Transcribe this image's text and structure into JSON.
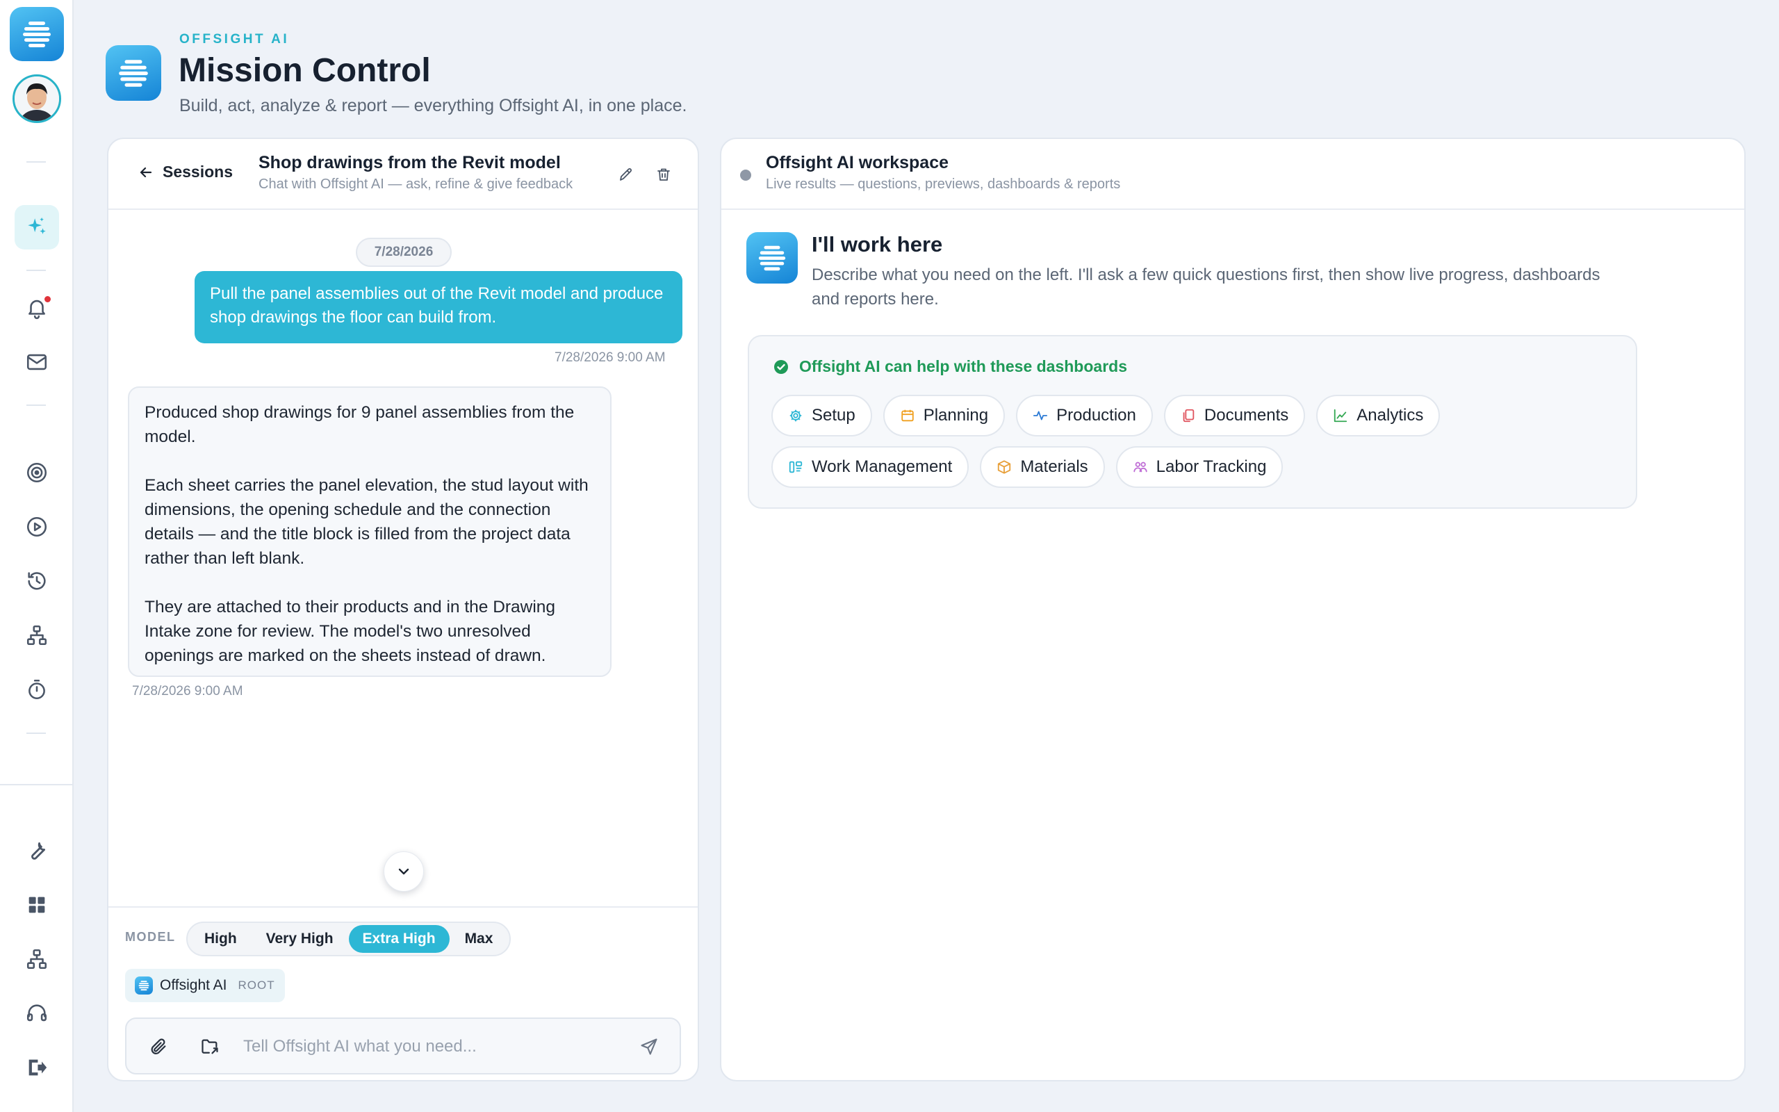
{
  "header": {
    "brand": "OFFSIGHT AI",
    "title": "Mission Control",
    "subtitle": "Build, act, analyze & report — everything Offsight AI, in one place."
  },
  "sidebar": {
    "top_items": [
      "ai-assistant",
      "notifications",
      "mail",
      "targets",
      "playback",
      "history",
      "hierarchy",
      "timer"
    ],
    "bottom_items": [
      "tools",
      "dashboards",
      "network",
      "support",
      "logout"
    ]
  },
  "chat": {
    "back_label": "Sessions",
    "session_title": "Shop drawings from the Revit model",
    "session_subtitle": "Chat with Offsight AI — ask, refine & give feedback",
    "date_pill": "7/28/2026",
    "user_message": "Pull the panel assemblies out of the Revit model and produce shop drawings the floor can build from.",
    "user_time": "7/28/2026 9:00 AM",
    "ai_paragraphs": [
      "Produced shop drawings for 9 panel assemblies from the model.",
      "Each sheet carries the panel elevation, the stud layout with dimensions, the opening schedule and the connection details — and the title block is filled from the project data rather than left blank.",
      "They are attached to their products and in the Drawing Intake zone for review. The model's two unresolved openings are marked on the sheets instead of drawn."
    ],
    "ai_time": "7/28/2026 9:00 AM",
    "model_label": "MODEL",
    "model_options": [
      "High",
      "Very High",
      "Extra High",
      "Max"
    ],
    "model_selected": "Extra High",
    "agent_name": "Offsight AI",
    "agent_tag": "ROOT",
    "composer_placeholder": "Tell Offsight AI what you need..."
  },
  "workspace": {
    "title": "Offsight AI workspace",
    "subtitle": "Live results — questions, previews, dashboards & reports",
    "heading": "I'll work here",
    "description": "Describe what you need on the left. I'll ask a few quick questions first, then show live progress, dashboards and reports here.",
    "dash_header": "Offsight AI can help with these dashboards",
    "dashboards": [
      {
        "label": "Setup",
        "icon": "gear-icon",
        "color": "#2db7d5"
      },
      {
        "label": "Planning",
        "icon": "calendar-icon",
        "color": "#f0a020"
      },
      {
        "label": "Production",
        "icon": "pulse-icon",
        "color": "#2d7bd5"
      },
      {
        "label": "Documents",
        "icon": "documents-icon",
        "color": "#e0555f"
      },
      {
        "label": "Analytics",
        "icon": "chart-icon",
        "color": "#34a853"
      },
      {
        "label": "Work Management",
        "icon": "kanban-icon",
        "color": "#2db7d5"
      },
      {
        "label": "Materials",
        "icon": "box-icon",
        "color": "#e8a03a"
      },
      {
        "label": "Labor Tracking",
        "icon": "people-icon",
        "color": "#c06fd6"
      }
    ]
  },
  "colors": {
    "accent": "#2db7d5",
    "brand_gradient_start": "#52c3f3",
    "brand_gradient_end": "#1584d6",
    "success": "#1f9a58"
  }
}
